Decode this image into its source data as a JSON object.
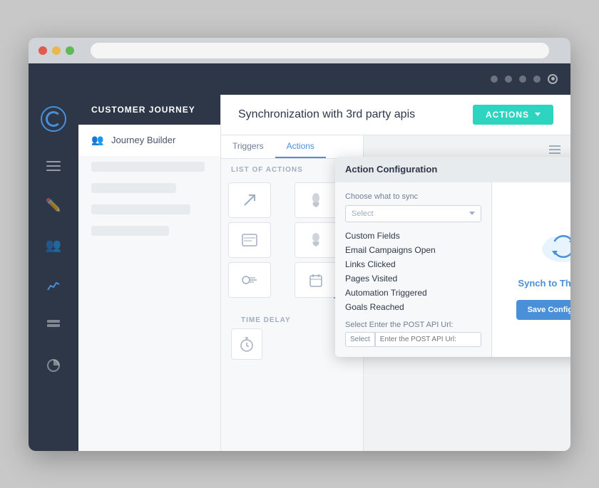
{
  "browser": {
    "dot_red": "red",
    "dot_yellow": "yellow",
    "dot_green": "green"
  },
  "topbar": {
    "circles": [
      "c1",
      "c2",
      "c3",
      "c4"
    ],
    "target": "target"
  },
  "sidebar": {
    "logo_label": "logo",
    "icons": [
      "hamburger",
      "edit",
      "users",
      "chart",
      "list",
      "pie"
    ]
  },
  "nav": {
    "section_header": "CUSTOMER JOURNEY",
    "item_label": "Journey Builder",
    "item_icon": "👥"
  },
  "workspace": {
    "title": "Synchronization with 3rd party apis",
    "actions_button": "ACTIONS",
    "tabs": [
      "Triggers",
      "Actions"
    ],
    "active_tab": "Actions",
    "panel_label": "LIST OF ACTIONS",
    "time_delay_label": "TIME DELAY",
    "hamburger_menu": "menu"
  },
  "popup": {
    "title": "Action Configuration",
    "close": "×",
    "choose_label": "Choose what to sync",
    "select_placeholder": "Select",
    "sync_options": [
      "Custom Fields",
      "Email Campaigns Open",
      "Links Clicked",
      "Pages Visited",
      "Automation Triggered",
      "Goals Reached"
    ],
    "api_label": "Select  Enter the POST API Url:",
    "api_select": "Select",
    "api_input_placeholder": "Enter the POST API Url:",
    "sync_icon_label": "Synch to Third Party",
    "save_button": "Save Configuration"
  }
}
